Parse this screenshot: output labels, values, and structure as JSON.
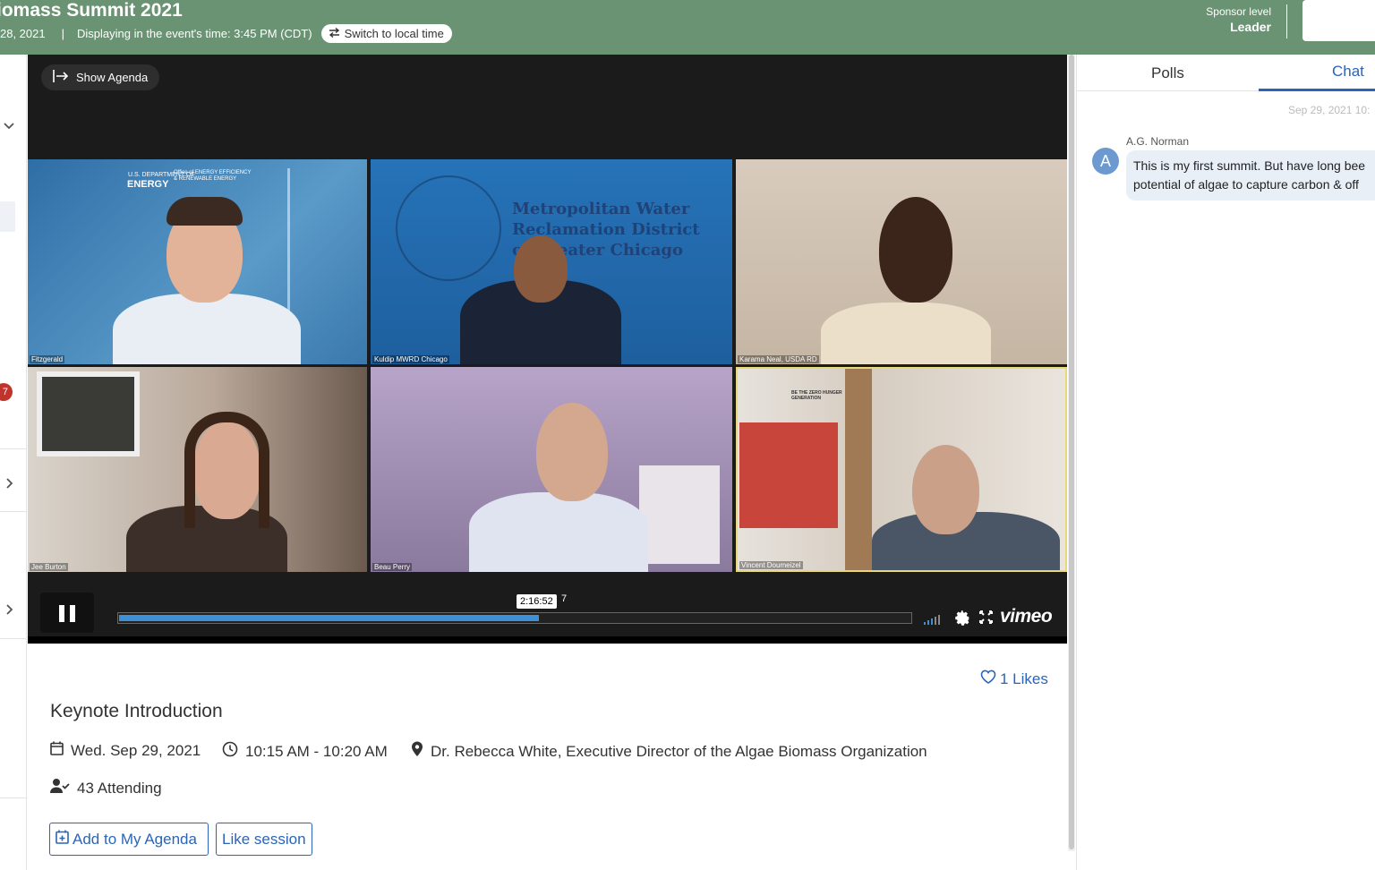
{
  "header": {
    "event_title": "iomass Summit 2021",
    "date_fragment": "28, 2021",
    "separator": "|",
    "timezone_text": "Displaying in the event's time: 3:45 PM (CDT)",
    "switch_label": "Switch to local time",
    "sponsor_label": "Sponsor level",
    "sponsor_value": "Leader",
    "bg_color": "#6a9373"
  },
  "left_rail": {
    "badge_count": "7"
  },
  "video": {
    "show_agenda_label": "Show Agenda",
    "participants": [
      {
        "name": "Fitzgerald"
      },
      {
        "name": "Kuldip MWRD Chicago"
      },
      {
        "name": "Karama Neal, USDA RD"
      },
      {
        "name": "Jee Burton"
      },
      {
        "name": "Beau Perry"
      },
      {
        "name": "Vincent Doumeizel"
      }
    ],
    "tile_texts": {
      "energy_logo": "ENERGY",
      "energy_sub": "U.S. DEPARTMENT OF",
      "energy_office": "Office of ENERGY EFFICIENCY & RENEWABLE ENERGY",
      "mwrd_line1": "Metropolitan Water",
      "mwrd_line2": "Reclamation District",
      "mwrd_line3": "of Greater Chicago",
      "poster_text": "BE THE ZERO HUNGER GENERATION"
    },
    "timecode": "2:16:52",
    "timecode_tail": "7",
    "progress": 0.53,
    "brand": "vimeo",
    "accent_color": "#3d8fd6"
  },
  "session": {
    "likes_label": "1 Likes",
    "title": "Keynote Introduction",
    "date": "Wed. Sep 29, 2021",
    "time": "10:15 AM - 10:20 AM",
    "location": "Dr. Rebecca White, Executive Director of the Algae Biomass Organization",
    "attending": "43 Attending",
    "add_agenda_label": "Add to My Agenda",
    "like_session_label": "Like session",
    "link_color": "#2b64b9"
  },
  "right_panel": {
    "tabs": [
      {
        "label": "Polls"
      },
      {
        "label": "Chat"
      }
    ],
    "active_tab": "Chat",
    "chat_date": "Sep 29, 2021 10:",
    "messages": [
      {
        "author": "A.G. Norman",
        "avatar_letter": "A",
        "line1": "This is my first summit. But have long bee",
        "line2": "potential of algae to capture carbon & off"
      }
    ]
  }
}
